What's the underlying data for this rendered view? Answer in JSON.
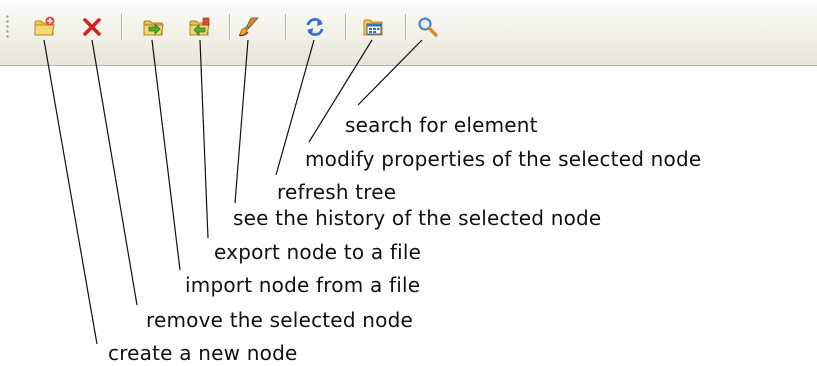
{
  "toolbar": {
    "buttons": [
      {
        "name": "create-node-button",
        "icon": "new-folder-icon"
      },
      {
        "name": "remove-node-button",
        "icon": "red-x-icon"
      },
      {
        "name": "import-node-button",
        "icon": "import-folder-icon"
      },
      {
        "name": "export-node-button",
        "icon": "export-folder-icon"
      },
      {
        "name": "history-button",
        "icon": "paintbrush-icon"
      },
      {
        "name": "refresh-tree-button",
        "icon": "refresh-icon"
      },
      {
        "name": "properties-button",
        "icon": "properties-window-icon"
      },
      {
        "name": "search-button",
        "icon": "magnifier-icon"
      }
    ]
  },
  "labels": {
    "search": "search for element",
    "properties": "modify properties of the selected node",
    "refresh": "refresh tree",
    "history": "see the history of the selected node",
    "export": "export node to a file",
    "import": "import node from a file",
    "remove": "remove the selected node",
    "create": "create a new node"
  },
  "colors": {
    "toolbar_background": "#f1f0e6",
    "remove_icon": "#d6201d",
    "folder_yellow": "#f2c94c",
    "folder_green": "#5aa832",
    "refresh_blue": "#2f6fcf",
    "text": "#111111"
  }
}
